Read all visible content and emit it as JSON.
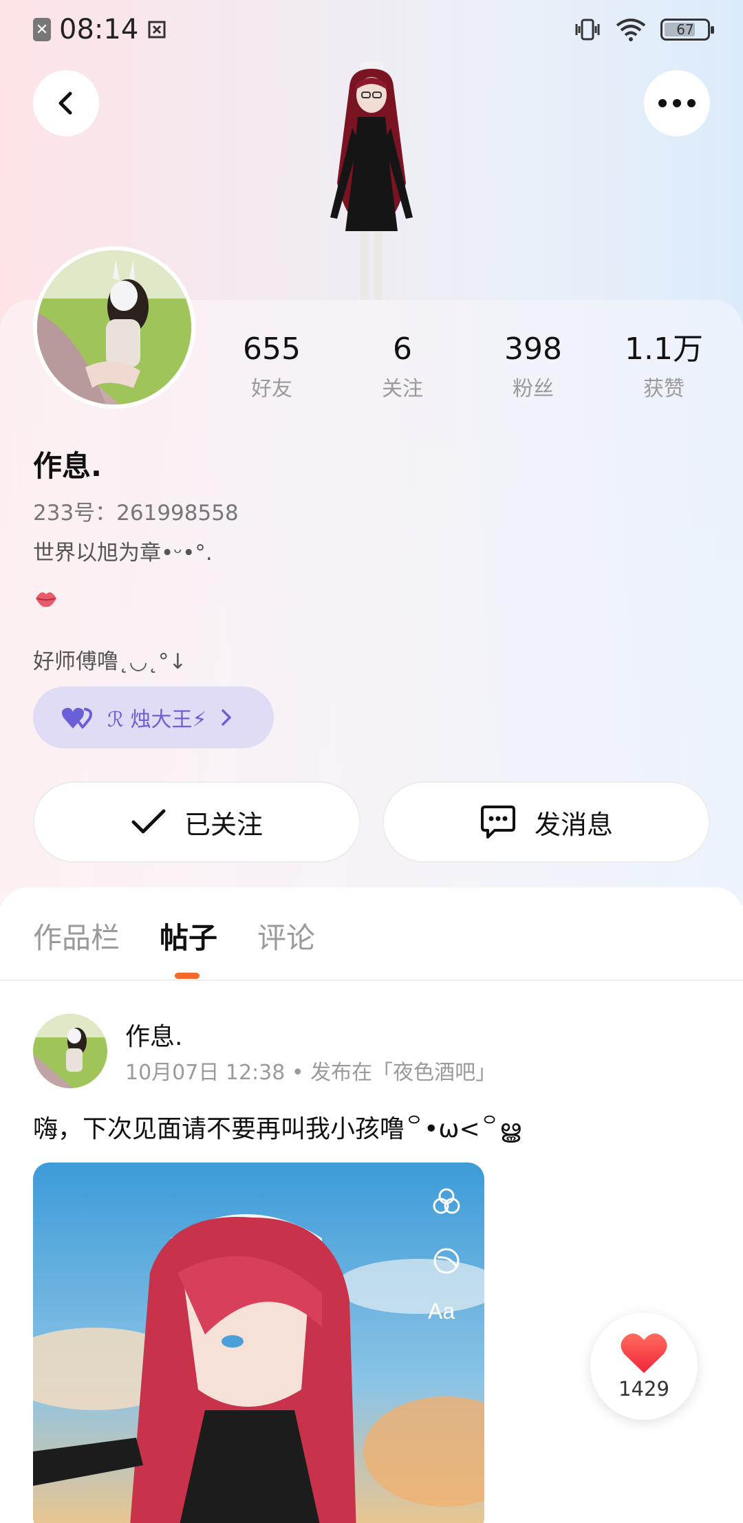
{
  "status_bar": {
    "time": "08:14",
    "battery": "67"
  },
  "profile": {
    "stats": [
      {
        "value": "655",
        "label": "好友"
      },
      {
        "value": "6",
        "label": "关注"
      },
      {
        "value": "398",
        "label": "粉丝"
      },
      {
        "value": "1.1万",
        "label": "获赞"
      }
    ],
    "name": "作息.",
    "uid": "233号：261998558",
    "bio_line1": "世界以旭为章•ᵕ•°.",
    "bio_line2": "好师傅噜˛◡˛°↓",
    "badge": {
      "text": "ℛ 烛大王⚡",
      "icon": "double-heart-icon",
      "color": "#6b5fd9"
    }
  },
  "actions": {
    "follow_label": "已关注",
    "message_label": "发消息"
  },
  "tabs": [
    {
      "label": "作品栏",
      "active": false
    },
    {
      "label": "帖子",
      "active": true
    },
    {
      "label": "评论",
      "active": false
    }
  ],
  "post": {
    "author": "作息.",
    "meta": "10月07日 12:38 • 发布在「夜色酒吧」",
    "text": "嗨，下次见面请不要再叫我小孩噜꒪•ω<꒪ൠ",
    "image_overlay_label": "Aa"
  },
  "like": {
    "count": "1429"
  },
  "colors": {
    "accent": "#f36a2a",
    "badge_bg": "#e0dcf6",
    "like_red": "#ff3b3b"
  }
}
